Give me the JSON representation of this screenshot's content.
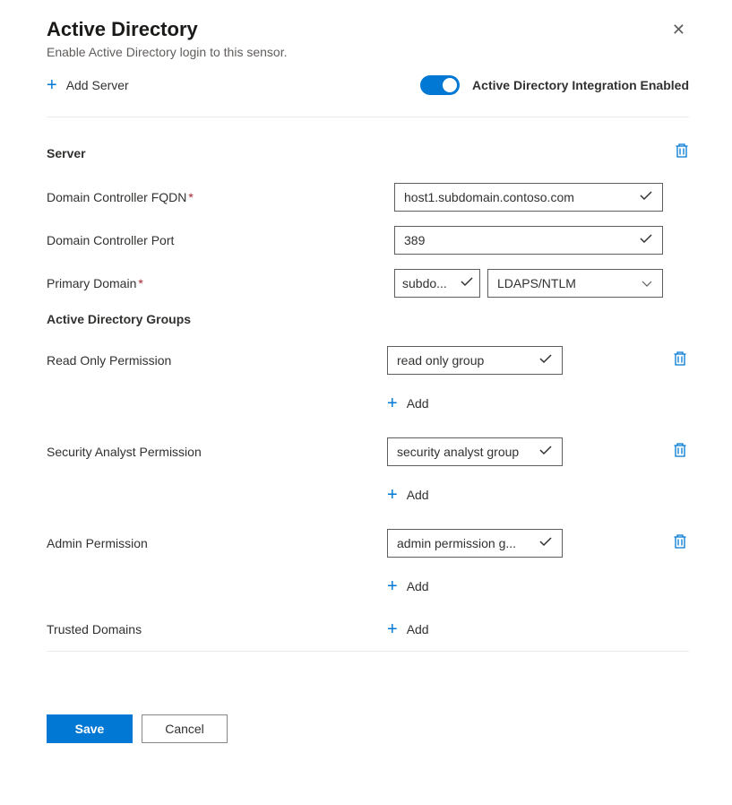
{
  "header": {
    "title": "Active Directory",
    "subtitle": "Enable Active Directory login to this sensor."
  },
  "controls": {
    "add_server_label": "Add Server",
    "toggle_label": "Active Directory Integration Enabled",
    "toggle_on": true
  },
  "server": {
    "section_title": "Server",
    "fqdn_label": "Domain Controller FQDN",
    "fqdn_value": "host1.subdomain.contoso.com",
    "port_label": "Domain Controller Port",
    "port_value": "389",
    "primary_domain_label": "Primary Domain",
    "primary_domain_value": "subdo...",
    "auth_value": "LDAPS/NTLM"
  },
  "groups": {
    "title": "Active Directory Groups",
    "read_only": {
      "label": "Read Only Permission",
      "value": "read only group"
    },
    "security_analyst": {
      "label": "Security Analyst Permission",
      "value": "security analyst group"
    },
    "admin": {
      "label": "Admin Permission",
      "value": "admin permission g..."
    },
    "trusted_domains_label": "Trusted Domains",
    "add_label": "Add"
  },
  "buttons": {
    "save": "Save",
    "cancel": "Cancel"
  }
}
